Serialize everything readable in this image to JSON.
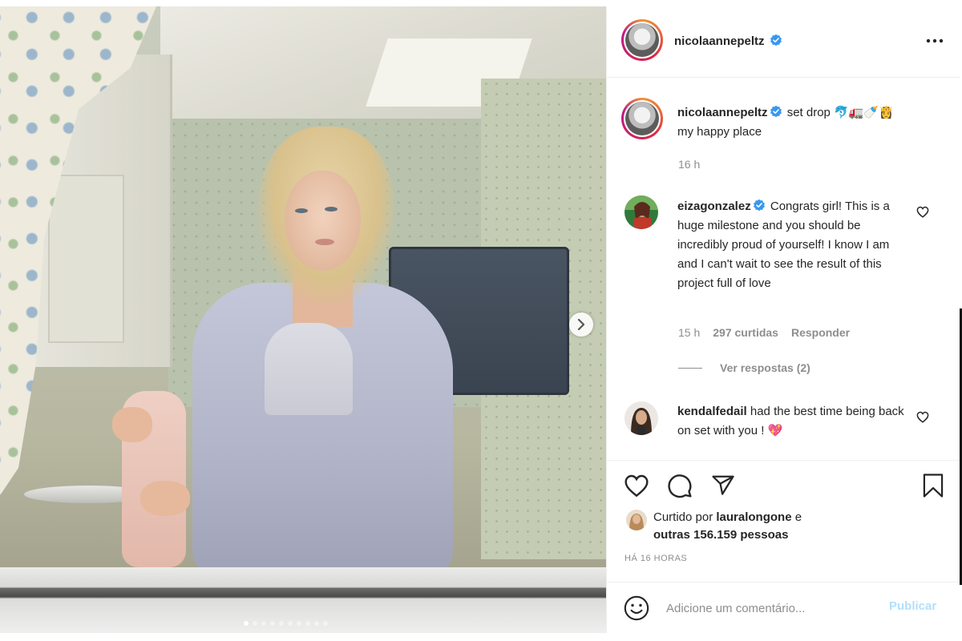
{
  "post": {
    "username": "nicolaannepeltz",
    "caption_text": "set drop 🐬🚛🍼👸",
    "caption_line2": "my happy place",
    "time": "16 h",
    "carousel_dots": 10,
    "carousel_active": 0
  },
  "comments": [
    {
      "username": "eizagonzalez",
      "verified": true,
      "text": "Congrats girl! This is a huge milestone and you should be incredibly proud of yourself! I know I am and I can't wait to see the result of this project full of love",
      "time": "15 h",
      "likes": "297 curtidas",
      "reply_label": "Responder",
      "view_replies": "Ver respostas (2)"
    },
    {
      "username": "kendalfedail",
      "verified": false,
      "text": "had the best time being back on set with you ! 💖"
    }
  ],
  "likes": {
    "prefix": "Curtido por",
    "user": "lauralongone",
    "conj": "e",
    "others": "outras 156.159 pessoas"
  },
  "post_time": "HÁ 16 HORAS",
  "comment_box": {
    "placeholder": "Adicione um comentário...",
    "publish_label": "Publicar"
  },
  "icons": {
    "verified": "verified-badge-icon",
    "more": "more-options-icon",
    "like": "heart-icon",
    "comment": "comment-icon",
    "share": "share-icon",
    "save": "bookmark-icon",
    "emoji": "emoji-icon",
    "next": "chevron-right-icon"
  },
  "colors": {
    "verified_blue": "#3897f0",
    "publish_disabled": "#b2dffc",
    "meta_gray": "#8e8e8e"
  }
}
